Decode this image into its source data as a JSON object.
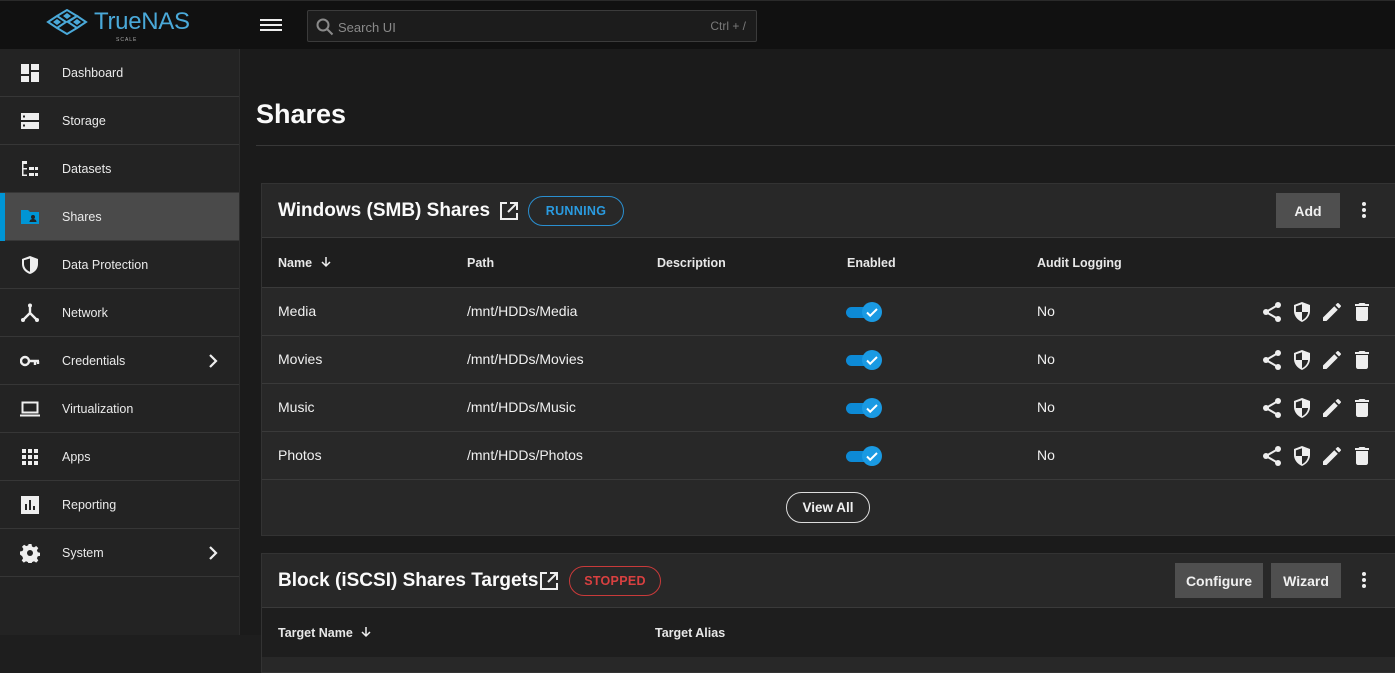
{
  "app": {
    "brand": "TrueNAS",
    "edition": "SCALE"
  },
  "search": {
    "placeholder": "Search UI",
    "shortcut": "Ctrl + /"
  },
  "sidebar": {
    "items": [
      {
        "label": "Dashboard",
        "icon": "dashboard-icon"
      },
      {
        "label": "Storage",
        "icon": "storage-icon"
      },
      {
        "label": "Datasets",
        "icon": "datasets-icon"
      },
      {
        "label": "Shares",
        "icon": "shares-icon",
        "active": true
      },
      {
        "label": "Data Protection",
        "icon": "shield-icon"
      },
      {
        "label": "Network",
        "icon": "network-icon"
      },
      {
        "label": "Credentials",
        "icon": "key-icon",
        "expandable": true
      },
      {
        "label": "Virtualization",
        "icon": "laptop-icon"
      },
      {
        "label": "Apps",
        "icon": "apps-grid-icon"
      },
      {
        "label": "Reporting",
        "icon": "bar-chart-icon"
      },
      {
        "label": "System",
        "icon": "gear-icon",
        "expandable": true
      }
    ]
  },
  "page": {
    "title": "Shares"
  },
  "smb": {
    "title": "Windows (SMB) Shares",
    "status": "RUNNING",
    "add_label": "Add",
    "columns": {
      "name": "Name",
      "path": "Path",
      "description": "Description",
      "enabled": "Enabled",
      "audit": "Audit Logging"
    },
    "rows": [
      {
        "name": "Media",
        "path": "/mnt/HDDs/Media",
        "description": "",
        "enabled": true,
        "audit": "No"
      },
      {
        "name": "Movies",
        "path": "/mnt/HDDs/Movies",
        "description": "",
        "enabled": true,
        "audit": "No"
      },
      {
        "name": "Music",
        "path": "/mnt/HDDs/Music",
        "description": "",
        "enabled": true,
        "audit": "No"
      },
      {
        "name": "Photos",
        "path": "/mnt/HDDs/Photos",
        "description": "",
        "enabled": true,
        "audit": "No"
      }
    ],
    "view_all_label": "View All"
  },
  "iscsi": {
    "title": "Block (iSCSI) Shares Targets",
    "status": "STOPPED",
    "configure_label": "Configure",
    "wizard_label": "Wizard",
    "columns": {
      "target_name": "Target Name",
      "target_alias": "Target Alias"
    }
  },
  "colors": {
    "accent": "#0095d5",
    "running": "#2a9be0",
    "stopped": "#d94040"
  }
}
